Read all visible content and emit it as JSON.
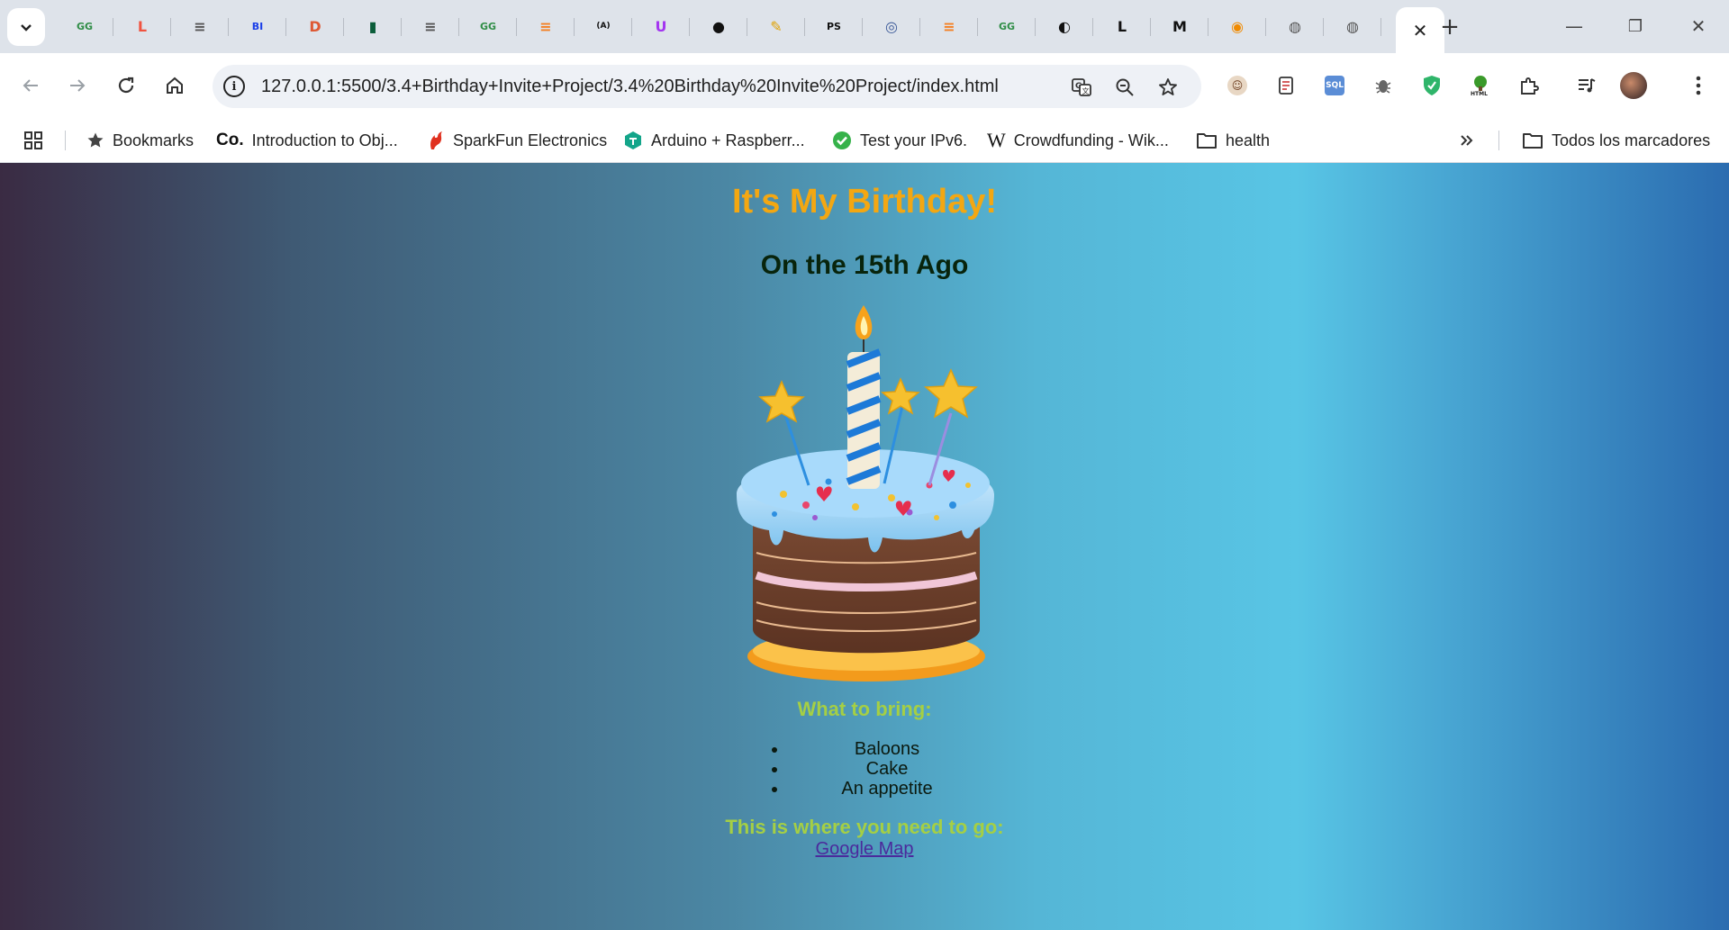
{
  "browser": {
    "tabs": [
      {
        "icon": "geeksforgeeks-icon",
        "glyph": "GG",
        "color": "#2f8d46"
      },
      {
        "icon": "laravel-icon",
        "glyph": "L",
        "color": "#f05340"
      },
      {
        "icon": "reader-icon",
        "glyph": "≡",
        "color": "#555"
      },
      {
        "icon": "bi-icon",
        "glyph": "BI",
        "color": "#1a3ee8"
      },
      {
        "icon": "duckduckgo-icon",
        "glyph": "D",
        "color": "#de5833"
      },
      {
        "icon": "bookmark-green-icon",
        "glyph": "▮",
        "color": "#0b5d3a"
      },
      {
        "icon": "reader-icon",
        "glyph": "≡",
        "color": "#555"
      },
      {
        "icon": "geeksforgeeks-icon",
        "glyph": "GG",
        "color": "#2f8d46"
      },
      {
        "icon": "stackoverflow-icon",
        "glyph": "≡",
        "color": "#f48024"
      },
      {
        "icon": "code-icon",
        "glyph": "(A)",
        "color": "#111"
      },
      {
        "icon": "udemy-icon",
        "glyph": "U",
        "color": "#a435f0"
      },
      {
        "icon": "github-icon",
        "glyph": "●",
        "color": "#111"
      },
      {
        "icon": "pen-icon",
        "glyph": "✎",
        "color": "#e0a100"
      },
      {
        "icon": "photoshop-icon",
        "glyph": "PS",
        "color": "#111"
      },
      {
        "icon": "react-icon",
        "glyph": "◎",
        "color": "#3b5998"
      },
      {
        "icon": "stackoverflow-icon",
        "glyph": "≡",
        "color": "#f48024"
      },
      {
        "icon": "geeksforgeeks-icon",
        "glyph": "GG",
        "color": "#2f8d46"
      },
      {
        "icon": "head-icon",
        "glyph": "◐",
        "color": "#111"
      },
      {
        "icon": "l-icon",
        "glyph": "L",
        "color": "#111"
      },
      {
        "icon": "m-icon",
        "glyph": "M",
        "color": "#111"
      },
      {
        "icon": "toggle-icon",
        "glyph": "◉",
        "color": "#f08a00"
      },
      {
        "icon": "globe-icon",
        "glyph": "◍",
        "color": "#555"
      },
      {
        "icon": "globe-icon",
        "glyph": "◍",
        "color": "#555"
      }
    ],
    "active_tab_close": "✕",
    "new_tab": "+",
    "window_controls": {
      "minimize": "—",
      "restore": "❐",
      "close": "✕"
    },
    "url": "127.0.0.1:5500/3.4+Birthday+Invite+Project/3.4%20Birthday%20Invite%20Project/index.html",
    "bookmarks": [
      {
        "label": "Bookmarks",
        "icon": "star-icon"
      },
      {
        "label": "Introduction to Obj...",
        "icon": "co-icon"
      },
      {
        "label": "SparkFun Electronics",
        "icon": "sparkfun-icon"
      },
      {
        "label": "Arduino + Raspberr...",
        "icon": "arduino-icon"
      },
      {
        "label": "Test your IPv6.",
        "icon": "check-icon"
      },
      {
        "label": "Crowdfunding - Wik...",
        "icon": "wikipedia-icon"
      },
      {
        "label": "health",
        "icon": "folder-icon"
      }
    ],
    "all_bookmarks": "Todos los marcadores"
  },
  "content": {
    "title": "It's My Birthday!",
    "date": "On the 15th Ago",
    "bring_heading": "What to bring:",
    "bring_items": [
      "Baloons",
      "Cake",
      "An appetite"
    ],
    "location_heading": "This is where you need to go:",
    "map_link": "Google Map"
  }
}
